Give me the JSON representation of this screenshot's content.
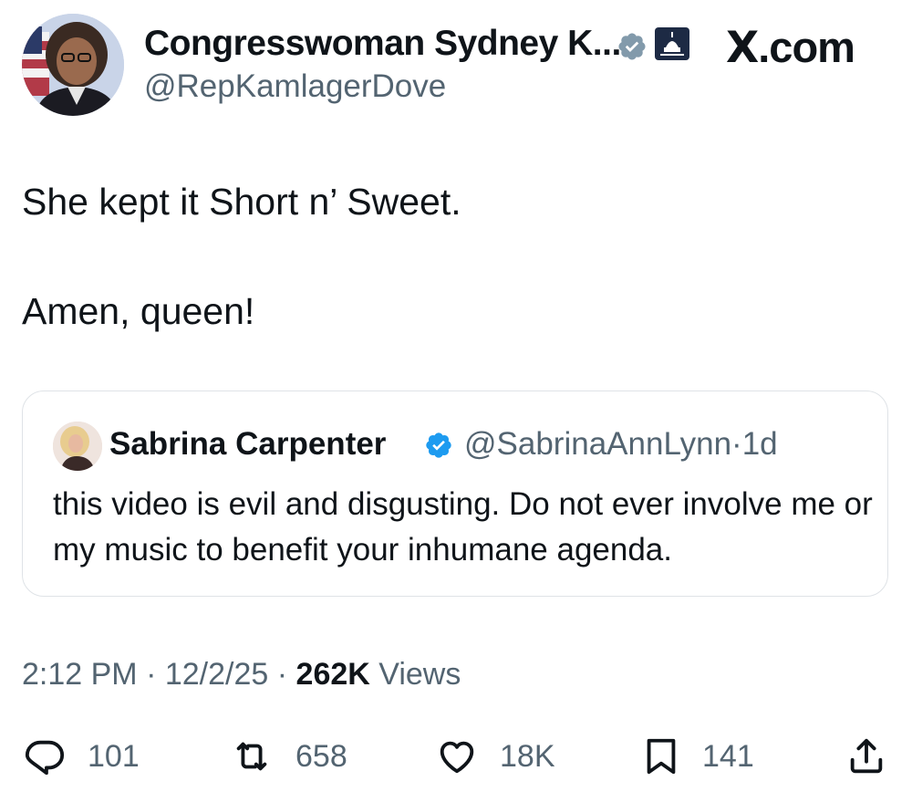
{
  "author": {
    "display_name": "Congresswoman Sydney K...",
    "handle": "@RepKamlagerDove",
    "verified": "gray-verified-badge",
    "affiliation_badge": "capitol-dome-icon"
  },
  "brand": {
    "x_letter": "X",
    "domain": ".com"
  },
  "tweet": {
    "line1": "She kept it Short n’ Sweet.",
    "line2": "Amen, queen!"
  },
  "quoted_tweet": {
    "display_name": "Sabrina Carpenter",
    "handle": "@SabrinaAnnLynn",
    "separator": "·",
    "age": "1d",
    "text": "this video is evil and disgusting. Do not ever involve me or my music to benefit your inhumane agenda."
  },
  "meta": {
    "time": "2:12 PM",
    "date": "12/2/25",
    "separator": "·",
    "views_count": "262K",
    "views_label": "Views"
  },
  "actions": {
    "replies": "101",
    "reposts": "658",
    "likes": "18K",
    "bookmarks": "141"
  },
  "colors": {
    "text": "#0f1419",
    "secondary": "#536471",
    "verified_blue": "#1d9bf0",
    "verified_gray": "#829aab",
    "border": "#dfe3e7"
  }
}
